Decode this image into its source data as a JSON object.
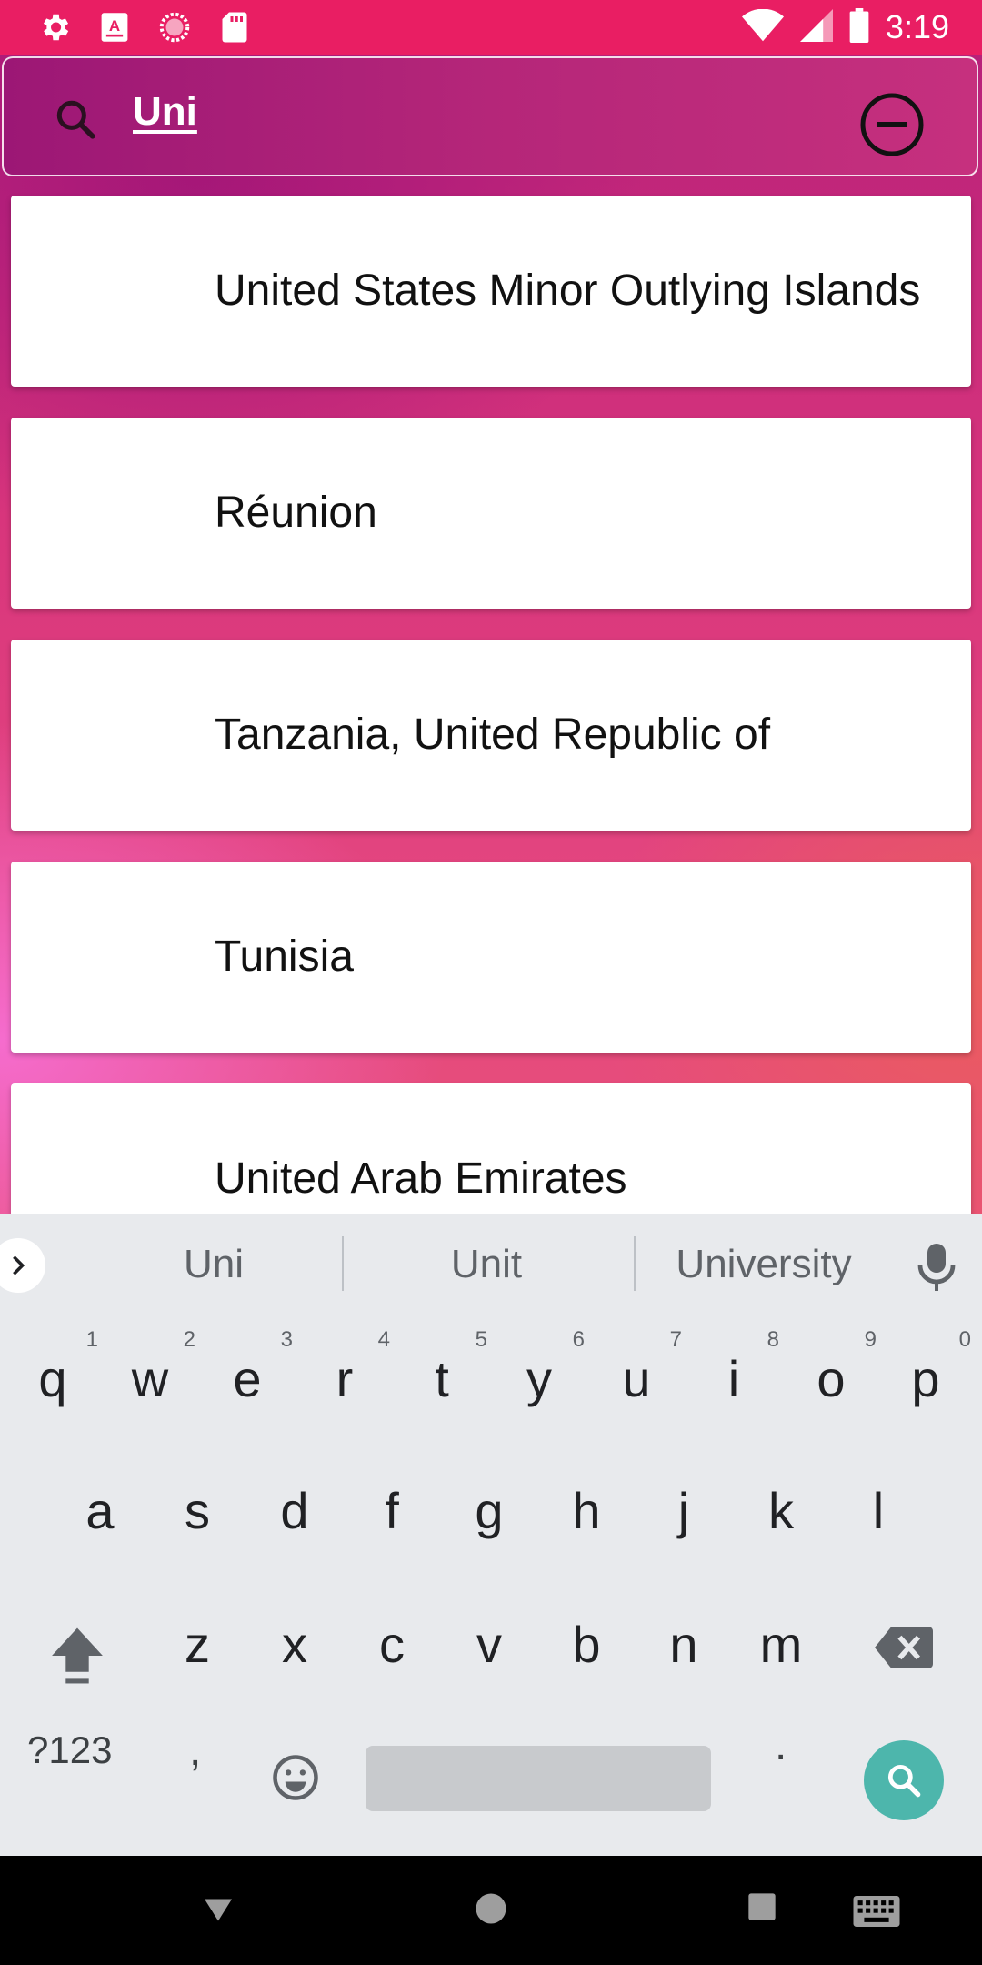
{
  "status_bar": {
    "time": "3:19",
    "left_icons": [
      "settings-icon",
      "font-app-icon",
      "loading-circle-icon",
      "sd-card-icon"
    ],
    "right_icons": [
      "wifi-icon",
      "signal-icon",
      "battery-icon"
    ]
  },
  "search": {
    "query": "Uni",
    "icon": "search-icon",
    "clear_icon": "minus-circle-icon"
  },
  "results": [
    {
      "label": "United States Minor Outlying Islands"
    },
    {
      "label": "Réunion"
    },
    {
      "label": "Tanzania, United Republic of"
    },
    {
      "label": "Tunisia"
    },
    {
      "label": "United Arab Emirates"
    }
  ],
  "keyboard": {
    "suggestions": [
      "Uni",
      "Unit",
      "University"
    ],
    "row1": [
      {
        "key": "q",
        "hint": "1"
      },
      {
        "key": "w",
        "hint": "2"
      },
      {
        "key": "e",
        "hint": "3"
      },
      {
        "key": "r",
        "hint": "4"
      },
      {
        "key": "t",
        "hint": "5"
      },
      {
        "key": "y",
        "hint": "6"
      },
      {
        "key": "u",
        "hint": "7"
      },
      {
        "key": "i",
        "hint": "8"
      },
      {
        "key": "o",
        "hint": "9"
      },
      {
        "key": "p",
        "hint": "0"
      }
    ],
    "row2": [
      "a",
      "s",
      "d",
      "f",
      "g",
      "h",
      "j",
      "k",
      "l"
    ],
    "row3": [
      "z",
      "x",
      "c",
      "v",
      "b",
      "n",
      "m"
    ],
    "symbols_label": "?123",
    "comma": ",",
    "period": ".",
    "accent_color": "#4db6ac"
  },
  "colors": {
    "status_bar": "#e91e63",
    "keyboard_bg": "#e8eaed",
    "card_bg": "#ffffff"
  }
}
